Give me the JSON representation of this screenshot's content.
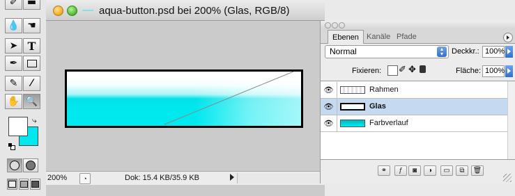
{
  "document": {
    "title": "aqua-button.psd bei 200% (Glas, RGB/8)",
    "status": {
      "zoom": "200%",
      "doc_info": "Dok: 15.4 KB/35.9 KB"
    }
  },
  "layers_panel": {
    "tabs": [
      "Ebenen",
      "Kanäle",
      "Pfade"
    ],
    "active_tab": "Ebenen",
    "blend_mode": "Normal",
    "opacity_label": "Deckkr.:",
    "opacity_value": "100%",
    "lock_label": "Fixieren:",
    "fill_label": "Fläche:",
    "fill_value": "100%",
    "layers": [
      {
        "name": "Rahmen",
        "selected": false
      },
      {
        "name": "Glas",
        "selected": true
      },
      {
        "name": "Farbverlauf",
        "selected": false
      }
    ]
  },
  "colors": {
    "accent": "#3c7be0",
    "selected_layer": "#c5d9f0",
    "cyan": "#00e2e8",
    "traffic_yellow": "#f2b231",
    "traffic_green": "#5cbf3c"
  },
  "tools": {
    "icons": [
      "pencil-icon",
      "eraser-icon",
      "blur-icon",
      "smudge-icon",
      "select-arrow-icon",
      "type-icon",
      "pen-icon",
      "rectangle-icon",
      "notes-icon",
      "eyedropper-icon",
      "hand-icon",
      "zoom-icon",
      "swap-colors-icon",
      "default-colors-icon",
      "standard-mode-icon",
      "quickmask-mode-icon",
      "screen-mode-icon"
    ]
  }
}
